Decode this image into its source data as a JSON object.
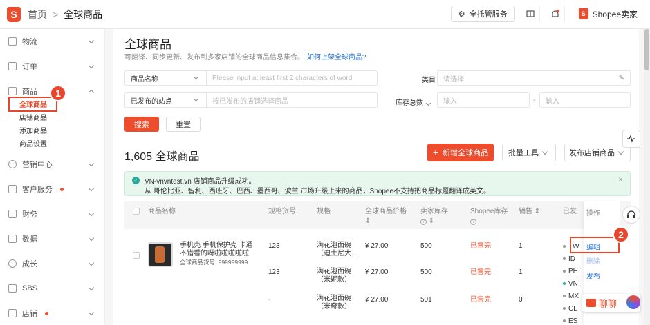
{
  "header": {
    "breadcrumb_home": "首页",
    "breadcrumb_sep": ">",
    "breadcrumb_current": "全球商品",
    "managed_service": "全托管服务",
    "shop_name": "Shopee卖家"
  },
  "sidebar": {
    "logistics": "物流",
    "orders": "订单",
    "products": "商品",
    "product_items": [
      "全球商品",
      "店铺商品",
      "添加商品",
      "商品设置"
    ],
    "marketing": "营销中心",
    "customer_service": "客户服务",
    "finance": "财务",
    "data": "数据",
    "growth": "成长",
    "sbs": "SBS",
    "shop": "店铺"
  },
  "page": {
    "title": "全球商品",
    "desc": "可翻译、同步更新、发布到多家店铺的全球商品信息集合。",
    "help_link": "如何上架全球商品?"
  },
  "filters": {
    "name_select": "商品名称",
    "name_placeholder": "Please input at least first 2 characters of word",
    "category_label": "类目",
    "category_placeholder": "请选择",
    "site_select": "已发布的站点",
    "site_placeholder": "按已发布的店铺选择商品",
    "stock_label": "库存总数",
    "stock_min_placeholder": "输入",
    "stock_sep": "-",
    "stock_max_placeholder": "输入",
    "search": "搜索",
    "reset": "重置"
  },
  "list": {
    "count_title": "1,605 全球商品",
    "add_button": "新增全球商品",
    "batch_tools": "批量工具",
    "publish_shop": "发布店铺商品"
  },
  "alert": {
    "line1": "VN-vnvntest.vn 店铺商品升级成功。",
    "line2": "从 哥伦比亚、智利、西班牙、巴西、墨西哥、波兰 市场升级上来的商品，Shopee不支持把商品标题翻译成英文。",
    "close": "×"
  },
  "table": {
    "headers": {
      "name": "商品名称",
      "sku_code": "规格货号",
      "spec": "规格",
      "price": "全球商品价格",
      "seller_stock": "卖家库存",
      "shopee_stock": "Shopee库存",
      "sales": "销售",
      "published": "已发",
      "ops": "操作"
    },
    "product": {
      "name": "手机壳 手机保护壳 卡通 不错看的呀啦啦啦啦啦",
      "code": "全球商品货号: 999999999"
    },
    "rows": [
      {
        "sku": "123",
        "spec": "满花泡面碗（迪士尼大...",
        "price": "¥ 27.00",
        "stock": "500",
        "shopee": "已售完",
        "sales": "1"
      },
      {
        "sku": "123",
        "spec": "满花泡面碗（米妮款）",
        "price": "¥ 27.00",
        "stock": "500",
        "shopee": "已售完",
        "sales": "1"
      },
      {
        "sku": "-",
        "spec": "满花泡面碗（米奇款）",
        "price": "¥ 27.00",
        "stock": "501",
        "shopee": "已售完",
        "sales": "0"
      }
    ],
    "sites": [
      "TW",
      "ID",
      "PH",
      "VN",
      "MX",
      "CL",
      "ES"
    ],
    "ops": {
      "edit": "编辑",
      "delete": "删除",
      "publish": "发布"
    }
  },
  "annotations": {
    "badge1": "1",
    "badge2": "2"
  },
  "chat": {
    "label": "聊聊"
  }
}
